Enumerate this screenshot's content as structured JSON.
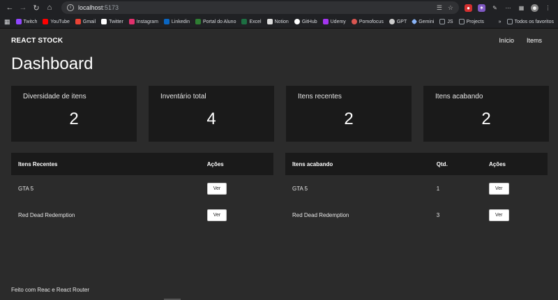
{
  "browser": {
    "url_host": "localhost",
    "url_port": ":5173",
    "bookmarks": [
      {
        "label": "Twitch",
        "color": "#9146ff"
      },
      {
        "label": "YouTube",
        "color": "#ff0000"
      },
      {
        "label": "Gmail",
        "color": "#ea4335"
      },
      {
        "label": "Twitter",
        "color": "#ffffff"
      },
      {
        "label": "Instagram",
        "color": "#e1306c"
      },
      {
        "label": "Linkedin",
        "color": "#0a66c2"
      },
      {
        "label": "Portal do Aluno",
        "color": "#2e7d32"
      },
      {
        "label": "Excel",
        "color": "#1d6f42"
      },
      {
        "label": "Notion",
        "color": "#dddddd"
      },
      {
        "label": "GitHub",
        "color": "#ffffff"
      },
      {
        "label": "Udemy",
        "color": "#a435f0"
      },
      {
        "label": "Pomofocus",
        "color": "#d95550"
      },
      {
        "label": "GPT",
        "color": "#cccccc"
      },
      {
        "label": "Gemini",
        "color": "#8ab4f8"
      },
      {
        "label": "JS",
        "color": "#9aa0a6"
      },
      {
        "label": "Projects",
        "color": "#9aa0a6"
      }
    ],
    "overflow_label": "»",
    "all_bookmarks_label": "Todos os favoritos"
  },
  "app": {
    "brand": "REACT STOCK",
    "nav": {
      "home": "Início",
      "items": "Items"
    },
    "title": "Dashboard"
  },
  "stats": [
    {
      "label": "Diversidade de itens",
      "value": "2"
    },
    {
      "label": "Inventário total",
      "value": "4"
    },
    {
      "label": "Itens recentes",
      "value": "2"
    },
    {
      "label": "Itens acabando",
      "value": "2"
    }
  ],
  "recent_table": {
    "headers": {
      "name": "Itens Recentes",
      "actions": "Ações"
    },
    "rows": [
      {
        "name": "GTA 5",
        "action": "Ver"
      },
      {
        "name": "Red Dead Redemption",
        "action": "Ver"
      }
    ]
  },
  "low_table": {
    "headers": {
      "name": "Itens acabando",
      "qty": "Qtd.",
      "actions": "Ações"
    },
    "rows": [
      {
        "name": "GTA 5",
        "qty": "1",
        "action": "Ver"
      },
      {
        "name": "Red Dead Redemption",
        "qty": "3",
        "action": "Ver"
      }
    ]
  },
  "footer": "Feito com Reac e React Router"
}
